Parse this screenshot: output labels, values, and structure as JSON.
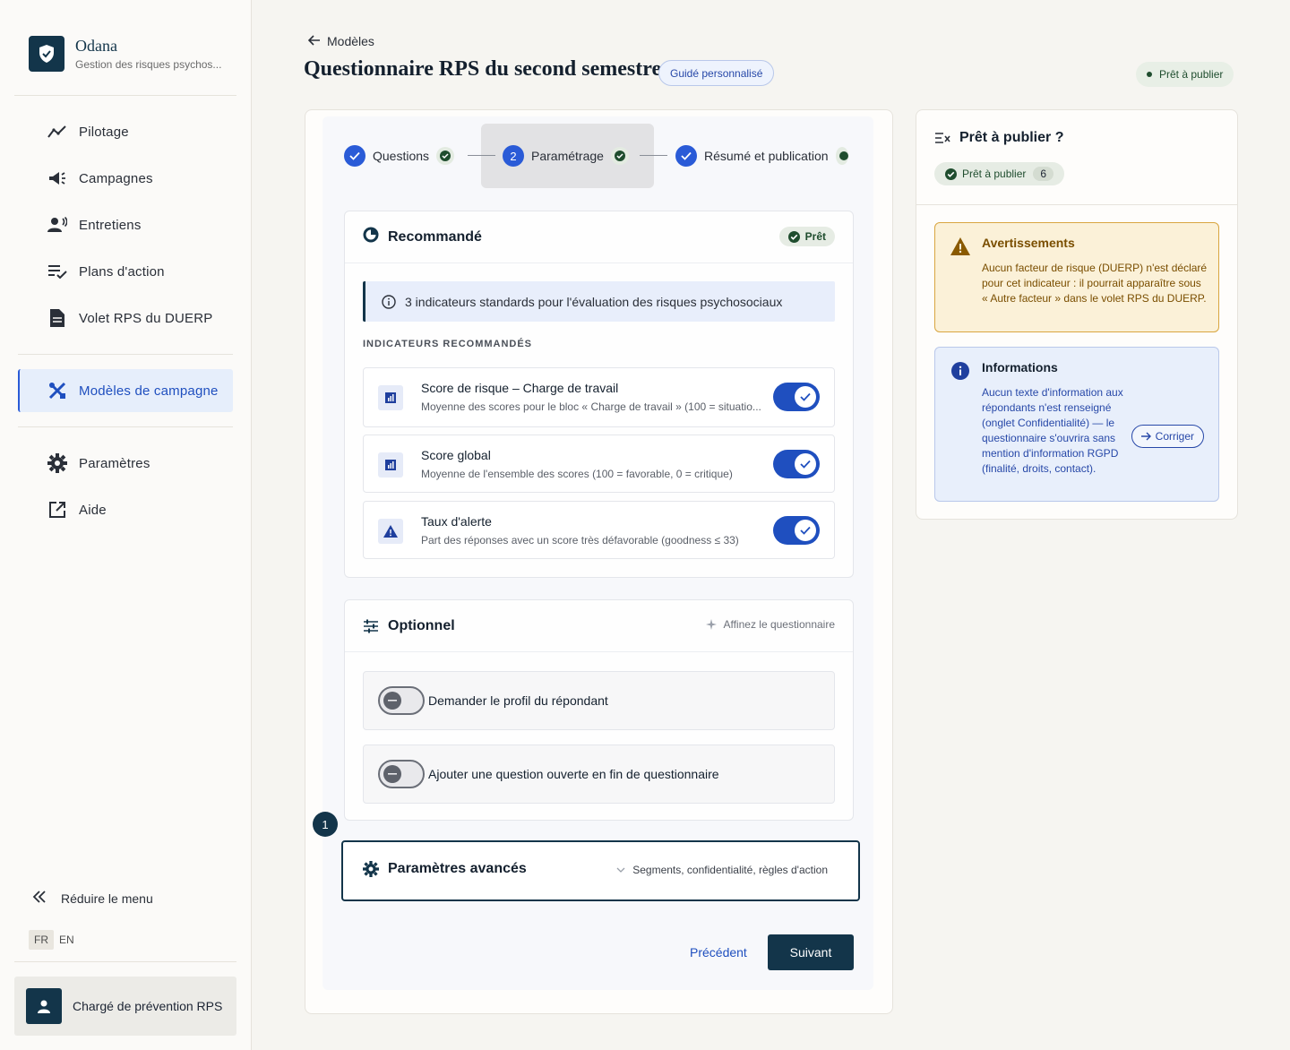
{
  "brand": {
    "name": "Odana",
    "subtitle": "Gestion des risques psychos..."
  },
  "nav": {
    "items": [
      {
        "label": "Pilotage",
        "icon": "chart-line-icon"
      },
      {
        "label": "Campagnes",
        "icon": "megaphone-icon"
      },
      {
        "label": "Entretiens",
        "icon": "person-voice-icon"
      },
      {
        "label": "Plans d'action",
        "icon": "list-check-icon"
      },
      {
        "label": "Volet RPS du DUERP",
        "icon": "document-icon"
      },
      {
        "label": "Modèles de campagne",
        "icon": "tools-icon",
        "active": true
      },
      {
        "label": "Paramètres",
        "icon": "gear-icon"
      },
      {
        "label": "Aide",
        "icon": "external-link-icon"
      }
    ],
    "reduce_label": "Réduire le menu",
    "languages": [
      "FR",
      "EN"
    ],
    "active_language": "FR",
    "user_role": "Chargé de prévention RPS"
  },
  "header": {
    "back_label": "Modèles",
    "title": "Questionnaire RPS du second semestre",
    "guided_badge": "Guidé personnalisé",
    "status_badge": "Prêt à publier"
  },
  "stepper": {
    "steps": [
      {
        "label": "Questions",
        "marker": "check"
      },
      {
        "label": "Paramétrage",
        "marker": "2",
        "active": true
      },
      {
        "label": "Résumé et publication",
        "marker": "check"
      }
    ]
  },
  "recommended": {
    "title": "Recommandé",
    "badge": "Prêt",
    "info": "3 indicateurs standards pour l'évaluation des risques psychosociaux",
    "section_label": "INDICATEURS RECOMMANDÉS",
    "indicators": [
      {
        "title": "Score de risque – Charge de travail",
        "subtitle": "Moyenne des scores pour le bloc « Charge de travail » (100 = situatio...",
        "icon": "bar-chart-icon",
        "enabled": true
      },
      {
        "title": "Score global",
        "subtitle": "Moyenne de l'ensemble des scores (100 = favorable, 0 = critique)",
        "icon": "bar-chart-icon",
        "enabled": true
      },
      {
        "title": "Taux d'alerte",
        "subtitle": "Part des réponses avec un score très défavorable (goodness ≤ 33)",
        "icon": "warning-icon",
        "enabled": true
      }
    ]
  },
  "optional": {
    "title": "Optionnel",
    "hint": "Affinez le questionnaire",
    "options": [
      {
        "label": "Demander le profil du répondant",
        "enabled": false
      },
      {
        "label": "Ajouter une question ouverte en fin de questionnaire",
        "enabled": false
      }
    ]
  },
  "advanced": {
    "step_number": "1",
    "title": "Paramètres avancés",
    "hint": "Segments, confidentialité, règles d'action"
  },
  "actions": {
    "prev": "Précédent",
    "next": "Suivant"
  },
  "side": {
    "title": "Prêt à publier ?",
    "pill_label": "Prêt à publier",
    "pill_count": "6",
    "warning": {
      "title": "Avertissements",
      "text": "Aucun facteur de risque (DUERP) n'est déclaré pour cet indicateur : il pourrait apparaître sous « Autre facteur » dans le volet RPS du DUERP."
    },
    "info": {
      "title": "Informations",
      "text": "Aucun texte d'information aux répondants n'est renseigné (onglet Confidentialité) — le questionnaire s'ouvrira sans mention d'information RGPD (finalité, droits, contact).",
      "fix_label": "Corriger"
    }
  },
  "colors": {
    "brand": "#13354a",
    "accent": "#1f4fbf",
    "success": "#1f4d2e",
    "warning": "#d9a640"
  }
}
